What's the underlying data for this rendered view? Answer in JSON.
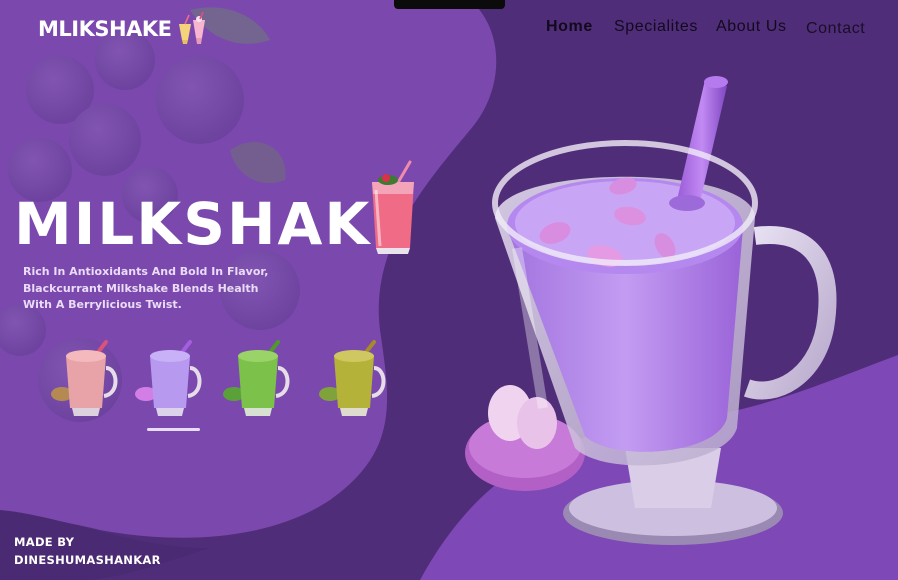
{
  "brand": {
    "logo_text": "MLIKSHAKE"
  },
  "nav": {
    "home": "Home",
    "specialites": "Specialites",
    "about": "About Us",
    "contact": "Contact"
  },
  "hero": {
    "title": "MILKSHAKE",
    "description_lines": [
      "Rich In Antioxidants And Bold In Flavor,",
      " Blackcurrant Milkshake Blends Health",
      "With A Berrylicious Twist."
    ]
  },
  "thumbnails": [
    {
      "name": "strawberry",
      "color": "#e8a3a8"
    },
    {
      "name": "blackcurrant",
      "color": "#b79af0",
      "selected": true
    },
    {
      "name": "pistachio",
      "color": "#7cc24a"
    },
    {
      "name": "mango-pistachio",
      "color": "#b5b23a"
    }
  ],
  "footer": {
    "credit_label": "MADE BY",
    "credit_name": "DINESHUMASHANKAR"
  },
  "colors": {
    "background_dark": "#4f2d79",
    "background_blob": "#7b48ae",
    "accent_purple": "#9a63d8"
  }
}
